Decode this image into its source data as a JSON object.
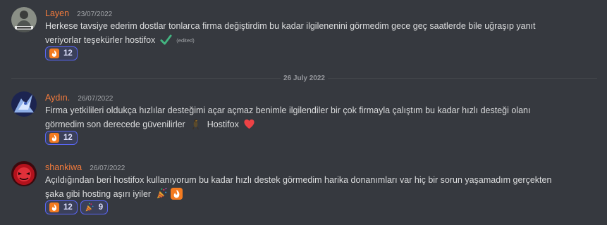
{
  "date_divider": "26 July 2022",
  "messages": [
    {
      "author": "Layen",
      "author_color": "#f47b3c",
      "timestamp": "23/07/2022",
      "text": "Herkese tavsiye ederim dostlar tonlarca firma değiştirdim bu kadar ilgilenenini görmedim gece geç saatlerde bile uğraşıp yanıt veriyorlar teşekürler hostifox",
      "trailing_emoji": "white-check-mark",
      "edited_label": "(edited)",
      "reactions": [
        {
          "emoji": "hostifox-logo",
          "count": "12"
        }
      ]
    },
    {
      "author": "Aydın.",
      "author_color": "#f47b3c",
      "timestamp": "26/07/2022",
      "text": "Firma yetkilileri oldukça hızlılar desteğimi açar açmaz benimle ilgilendiler bir çok firmayla çalıştım bu kadar hızlı desteği olanı görmedim son derecede güvenilirler",
      "inline_emoji": "bird-emoji",
      "text_after_emoji": "Hostifox",
      "trailing_emoji": "red-heart",
      "reactions": [
        {
          "emoji": "hostifox-logo",
          "count": "12"
        }
      ]
    },
    {
      "author": "shankiwa",
      "author_color": "#f47b3c",
      "timestamp": "26/07/2022",
      "text": "Açıldığından beri hostifox kullanıyorum bu kadar hızlı destek görmedim harika donanımları var hiç bir sorun yaşamadım gerçekten şaka gibi hosting aşırı iyiler",
      "trailing_emoji": "party-popper",
      "trailing_emoji_2": "hostifox-logo",
      "reactions": [
        {
          "emoji": "hostifox-logo",
          "count": "12"
        },
        {
          "emoji": "party-popper",
          "count": "9"
        }
      ]
    }
  ],
  "colors": {
    "background": "#36393f",
    "text": "#dcddde",
    "muted": "#a3a6aa",
    "reaction_active_border": "#5865f2",
    "hostifox_orange": "#f47b20",
    "check_green": "#43b581",
    "heart_red": "#ed4245"
  }
}
